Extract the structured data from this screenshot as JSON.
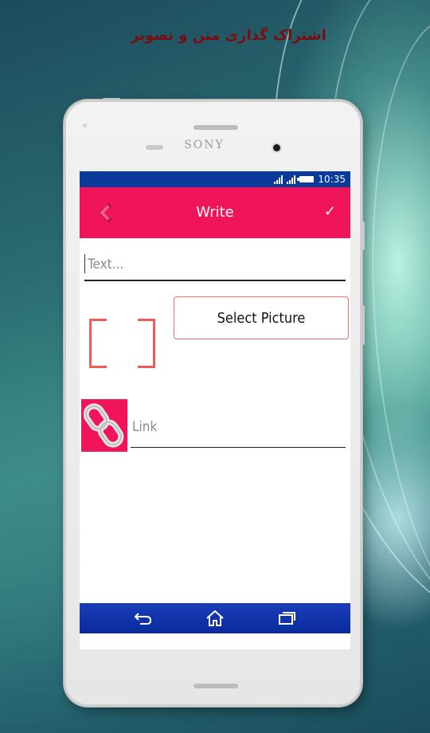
{
  "headline": "اشتراک گذاری متن و تصویر",
  "device": {
    "brand": "SONY"
  },
  "status_bar": {
    "time": "10:35"
  },
  "app_bar": {
    "title": "Write",
    "confirm_glyph": "✓"
  },
  "text_field": {
    "placeholder": "Text...",
    "value": ""
  },
  "picture": {
    "button_label": "Select Picture"
  },
  "link_field": {
    "placeholder": "Link",
    "value": ""
  },
  "nav_bar": {
    "items": [
      "back-icon",
      "home-icon",
      "recents-icon"
    ]
  },
  "colors": {
    "accent": "#f0145a",
    "status_bar": "#0a3a9a",
    "nav_bar": "#0a2a9c",
    "frame": "#ef5a5a",
    "headline": "#7a0c12"
  }
}
